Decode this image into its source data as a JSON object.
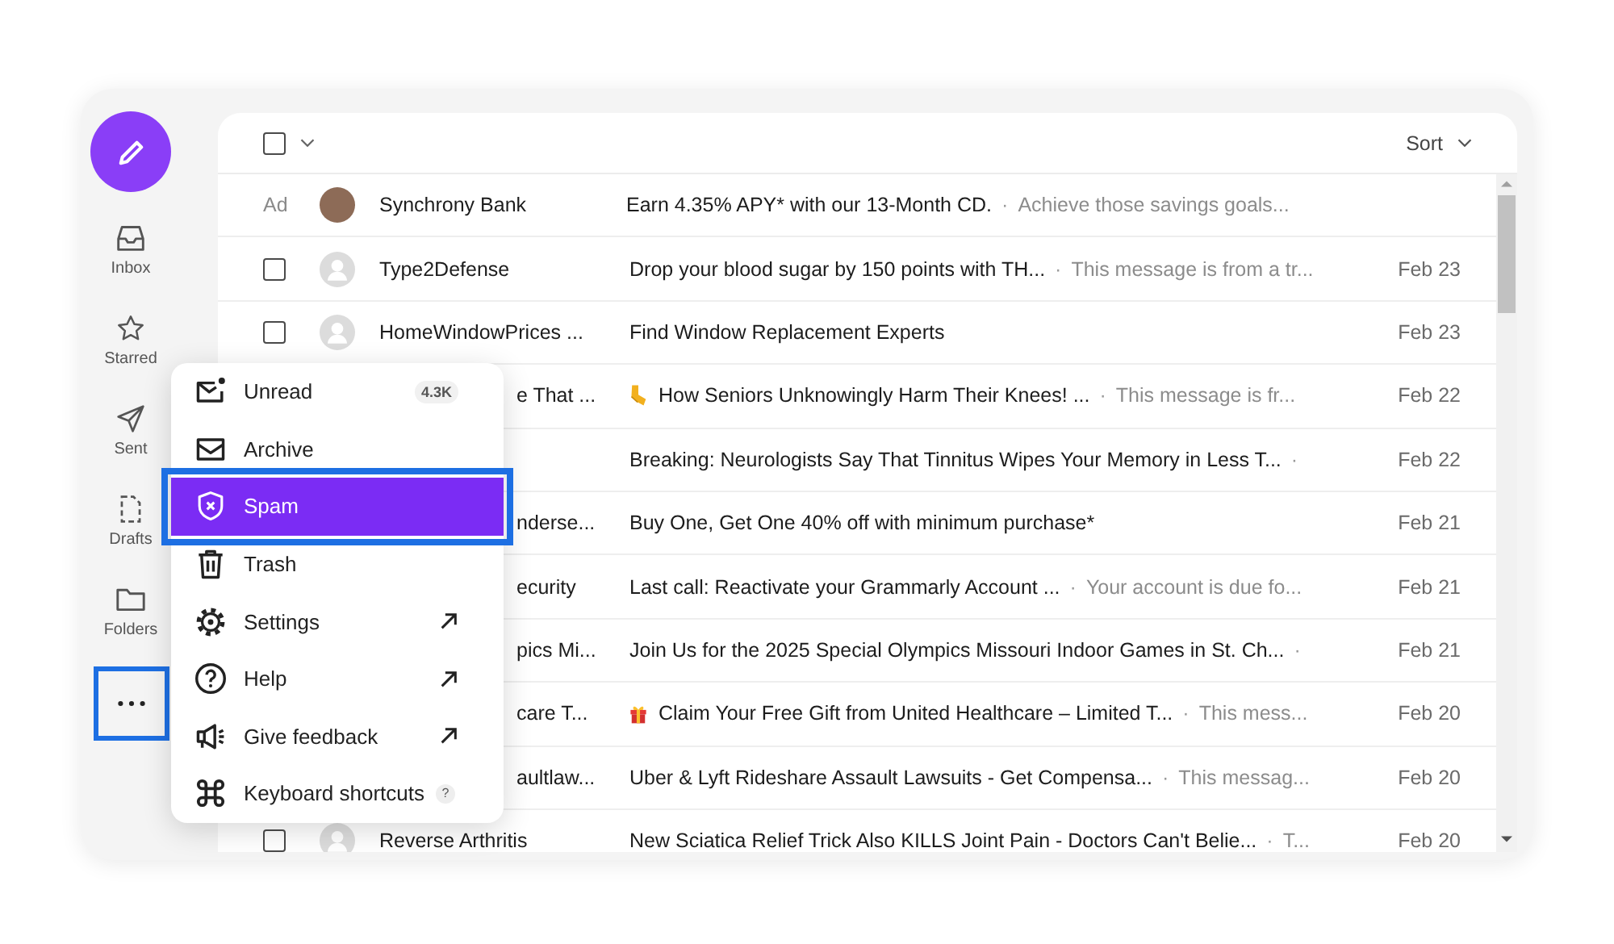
{
  "sidebar": {
    "items": [
      {
        "label": "Inbox",
        "selected": false
      },
      {
        "label": "Starred",
        "selected": false
      },
      {
        "label": "Sent",
        "selected": false
      },
      {
        "label": "Drafts",
        "selected": false
      },
      {
        "label": "Folders",
        "selected": false
      }
    ],
    "more_button": {
      "highlighted": true
    }
  },
  "menu": {
    "items": [
      {
        "label": "Unread",
        "badge": "4.3K",
        "external": false,
        "selected": false,
        "highlighted": false
      },
      {
        "label": "Archive",
        "external": false,
        "selected": false,
        "highlighted": false
      },
      {
        "label": "Spam",
        "external": false,
        "selected": true,
        "highlighted": true
      },
      {
        "label": "Trash",
        "external": false,
        "selected": false,
        "highlighted": false
      },
      {
        "label": "Settings",
        "external": true,
        "selected": false,
        "highlighted": false
      },
      {
        "label": "Help",
        "external": true,
        "selected": false,
        "highlighted": false
      },
      {
        "label": "Give feedback",
        "external": true,
        "selected": false,
        "highlighted": false
      },
      {
        "label": "Keyboard shortcuts",
        "hint": "?",
        "external": false,
        "selected": false,
        "highlighted": false
      }
    ]
  },
  "list": {
    "select_all": {
      "checked": false
    },
    "sort": {
      "label": "Sort"
    },
    "rows": [
      {
        "kind": "ad",
        "label": "Ad",
        "sender": "Synchrony Bank",
        "subject": "Earn 4.35% APY* with our 13-Month CD.",
        "separator": "·",
        "snippet": "Achieve those savings goals..."
      },
      {
        "kind": "message",
        "checked": false,
        "sender": "Type2Defense",
        "subject": "Drop your blood sugar by 150 points with TH...",
        "separator": "·",
        "snippet": "This message is from a tr...",
        "date": "Feb 23"
      },
      {
        "kind": "message",
        "checked": false,
        "sender": "HomeWindowPrices ...",
        "subject": "Find Window Replacement Experts",
        "date": "Feb 23"
      },
      {
        "kind": "partial",
        "sender": "e That ...",
        "subject": "How Seniors Unknowingly Harm Their Knees! ...",
        "separator": "·",
        "snippet": "This message is fr...",
        "date": "Feb 22"
      },
      {
        "kind": "partial",
        "subject": "Breaking: Neurologists Say That Tinnitus Wipes Your Memory in Less T...",
        "separator": "·",
        "date": "Feb 22"
      },
      {
        "kind": "partial",
        "sender": "nderse...",
        "subject": "Buy One, Get One 40% off with minimum purchase*",
        "date": "Feb 21"
      },
      {
        "kind": "partial",
        "sender": "ecurity",
        "subject": "Last call: Reactivate your Grammarly Account ...",
        "separator": "·",
        "snippet": "Your account is due fo...",
        "date": "Feb 21"
      },
      {
        "kind": "partial",
        "sender": "pics Mi...",
        "subject": "Join Us for the 2025 Special Olympics Missouri Indoor Games in St. Ch...",
        "separator": "·",
        "date": "Feb 21"
      },
      {
        "kind": "partial",
        "sender": "care T...",
        "subject": "Claim Your Free Gift from United Healthcare – Limited T...",
        "separator": "·",
        "snippet": "This mess...",
        "date": "Feb 20"
      },
      {
        "kind": "partial",
        "sender": "aultlaw...",
        "subject": "Uber & Lyft Rideshare Assault Lawsuits - Get Compensa...",
        "separator": "·",
        "snippet": "This messag...",
        "date": "Feb 20"
      },
      {
        "kind": "message",
        "checked": false,
        "sender": "Reverse Arthritis",
        "subject": "New Sciatica Relief Trick Also KILLS Joint Pain - Doctors Can't Belie...",
        "separator": "·",
        "snippet": "T...",
        "date": "Feb 20"
      }
    ]
  }
}
